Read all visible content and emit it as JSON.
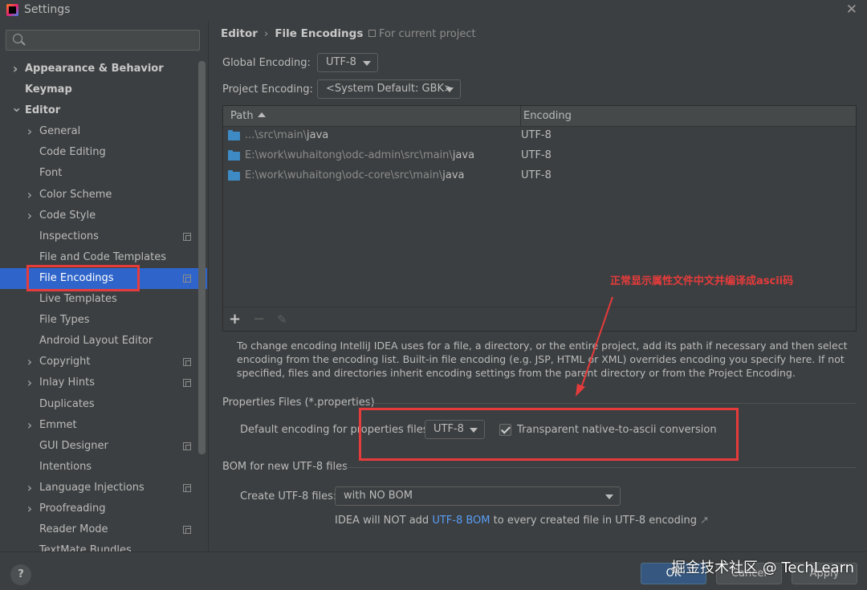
{
  "window": {
    "title": "Settings"
  },
  "sidebar": {
    "search_value": "",
    "items": [
      {
        "label": "Appearance & Behavior",
        "level": 0,
        "arrow": "right",
        "bold": true
      },
      {
        "label": "Keymap",
        "level": 0,
        "arrow": "",
        "bold": true
      },
      {
        "label": "Editor",
        "level": 0,
        "arrow": "down",
        "bold": true
      },
      {
        "label": "General",
        "level": 1,
        "arrow": "right"
      },
      {
        "label": "Code Editing",
        "level": 1,
        "arrow": ""
      },
      {
        "label": "Font",
        "level": 1,
        "arrow": ""
      },
      {
        "label": "Color Scheme",
        "level": 1,
        "arrow": "right"
      },
      {
        "label": "Code Style",
        "level": 1,
        "arrow": "right"
      },
      {
        "label": "Inspections",
        "level": 1,
        "arrow": "",
        "project": true
      },
      {
        "label": "File and Code Templates",
        "level": 1,
        "arrow": ""
      },
      {
        "label": "File Encodings",
        "level": 1,
        "arrow": "",
        "project": true,
        "selected": true
      },
      {
        "label": "Live Templates",
        "level": 1,
        "arrow": ""
      },
      {
        "label": "File Types",
        "level": 1,
        "arrow": ""
      },
      {
        "label": "Android Layout Editor",
        "level": 1,
        "arrow": ""
      },
      {
        "label": "Copyright",
        "level": 1,
        "arrow": "right",
        "project": true
      },
      {
        "label": "Inlay Hints",
        "level": 1,
        "arrow": "right",
        "project": true
      },
      {
        "label": "Duplicates",
        "level": 1,
        "arrow": ""
      },
      {
        "label": "Emmet",
        "level": 1,
        "arrow": "right"
      },
      {
        "label": "GUI Designer",
        "level": 1,
        "arrow": "",
        "project": true
      },
      {
        "label": "Intentions",
        "level": 1,
        "arrow": ""
      },
      {
        "label": "Language Injections",
        "level": 1,
        "arrow": "right",
        "project": true
      },
      {
        "label": "Proofreading",
        "level": 1,
        "arrow": "right"
      },
      {
        "label": "Reader Mode",
        "level": 1,
        "arrow": "",
        "project": true
      },
      {
        "label": "TextMate Bundles",
        "level": 1,
        "arrow": ""
      }
    ]
  },
  "header": {
    "breadcrumb_parent": "Editor",
    "breadcrumb_current": "File Encodings",
    "for_project": "For current project"
  },
  "global_encoding": {
    "label": "Global Encoding:",
    "value": "UTF-8"
  },
  "project_encoding": {
    "label": "Project Encoding:",
    "value": "<System Default: GBK>"
  },
  "table": {
    "col_path": "Path",
    "col_encoding": "Encoding",
    "rows": [
      {
        "prefix": "...\\src\\main\\",
        "leaf": "java",
        "encoding": "UTF-8"
      },
      {
        "prefix": "E:\\work\\wuhaitong\\odc-admin\\src\\main\\",
        "leaf": "java",
        "encoding": "UTF-8"
      },
      {
        "prefix": "E:\\work\\wuhaitong\\odc-core\\src\\main\\",
        "leaf": "java",
        "encoding": "UTF-8"
      }
    ]
  },
  "toolbar": {
    "add": "+",
    "remove": "−",
    "edit": "✎"
  },
  "help_text": "To change encoding IntelliJ IDEA uses for a file, a directory, or the entire project, add its path if necessary and then select encoding from the encoding list. Built-in file encoding (e.g. JSP, HTML or XML) overrides encoding you specify here. If not specified, files and directories inherit encoding settings from the parent directory or from the Project Encoding.",
  "properties": {
    "section_title": "Properties Files (*.properties)",
    "default_label": "Default encoding for properties files:",
    "default_value": "UTF-8",
    "transparent_label": "Transparent native-to-ascii conversion",
    "transparent_checked": true
  },
  "bom": {
    "section_title": "BOM for new UTF-8 files",
    "create_label": "Create UTF-8 files:",
    "create_value": "with NO BOM",
    "note_prefix": "IDEA will NOT add ",
    "note_link": "UTF-8 BOM",
    "note_suffix": " to every created file in UTF-8 encoding",
    "note_arrow": "↗"
  },
  "annotation": {
    "text": "正常显示属性文件中文并编译成ascii码",
    "color": "#e63b3b"
  },
  "footer": {
    "help": "?",
    "ok": "OK",
    "cancel": "Cancel",
    "apply": "Apply"
  },
  "watermark": "掘金技术社区 @ TechLearn"
}
